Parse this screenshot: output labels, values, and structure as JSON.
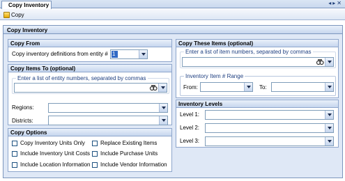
{
  "tab": {
    "title": "Copy Inventory"
  },
  "toolbar": {
    "copy_label": "Copy"
  },
  "panel": {
    "title": "Copy Inventory"
  },
  "copy_from": {
    "title": "Copy From",
    "entity_label": "Copy inventory definitions from entity #",
    "entity_value": "1"
  },
  "copy_items_to": {
    "title": "Copy Items To (optional)",
    "entities_hint": "Enter a list of entity numbers, separated by commas",
    "regions_label": "Regions:",
    "districts_label": "Districts:"
  },
  "copy_options": {
    "title": "Copy Options",
    "options": [
      "Copy Inventory Units Only",
      "Replace Existing Items",
      "Include Inventory Unit Costs",
      "Include Purchase Units",
      "Include Location Information",
      "Include Vendor Information"
    ]
  },
  "copy_these_items": {
    "title": "Copy These Items (optional)",
    "items_hint": "Enter a list of item numbers, separated by commas",
    "range_title": "Inventory Item # Range",
    "from_label": "From:",
    "to_label": "To:"
  },
  "inventory_levels": {
    "title": "Inventory Levels",
    "levels": [
      "Level 1:",
      "Level 2:",
      "Level 3:"
    ]
  },
  "icons": {
    "copy": "copy-icon",
    "search": "search-binoculars-icon",
    "dropdown": "chevron-down-icon"
  },
  "colors": {
    "header_bg": "#c6d6ee",
    "border": "#7c96bd",
    "panel_bg": "#dfe8f6",
    "selection": "#316ac5"
  }
}
